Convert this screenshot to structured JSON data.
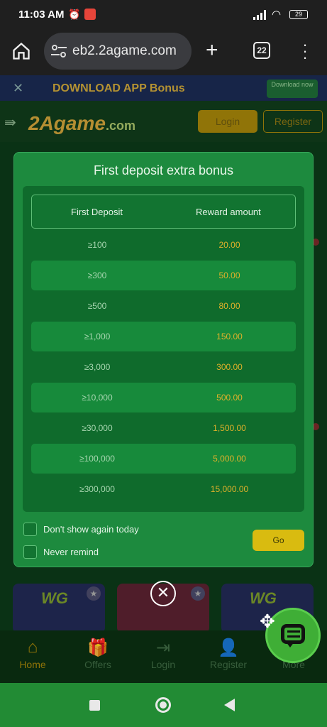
{
  "status": {
    "time": "11:03 AM",
    "battery": "29"
  },
  "browser": {
    "url": "eb2.2agame.com",
    "tab_count": "22"
  },
  "banner": {
    "text": "DOWNLOAD APP Bonus",
    "button": "Download now"
  },
  "site": {
    "logo": "2Agame",
    "logo_suffix": ".com",
    "login": "Login",
    "register": "Register"
  },
  "modal": {
    "title": "First deposit extra bonus",
    "headers": [
      "First Deposit",
      "Reward amount"
    ],
    "rows": [
      {
        "deposit": "≥100",
        "reward": "20.00"
      },
      {
        "deposit": "≥300",
        "reward": "50.00"
      },
      {
        "deposit": "≥500",
        "reward": "80.00"
      },
      {
        "deposit": "≥1,000",
        "reward": "150.00"
      },
      {
        "deposit": "≥3,000",
        "reward": "300.00"
      },
      {
        "deposit": "≥10,000",
        "reward": "500.00"
      },
      {
        "deposit": "≥30,000",
        "reward": "1,500.00"
      },
      {
        "deposit": "≥100,000",
        "reward": "5,000.00"
      },
      {
        "deposit": "≥300,000",
        "reward": "15,000.00"
      }
    ],
    "dont_show": "Don't show again today",
    "never_remind": "Never remind",
    "go": "Go"
  },
  "game_cards": [
    {
      "brand": "WG"
    },
    {
      "brand": "WG"
    }
  ],
  "nav": {
    "home": "Home",
    "offers": "Offers",
    "login": "Login",
    "register": "Register",
    "more": "More"
  },
  "icons": {
    "home": "home-icon",
    "tune": "tune-icon",
    "plus": "plus-icon",
    "tabs": "tabs-icon",
    "menu": "kebab-menu-icon",
    "close": "close-icon",
    "chat": "chat-icon",
    "drag": "move-icon"
  }
}
